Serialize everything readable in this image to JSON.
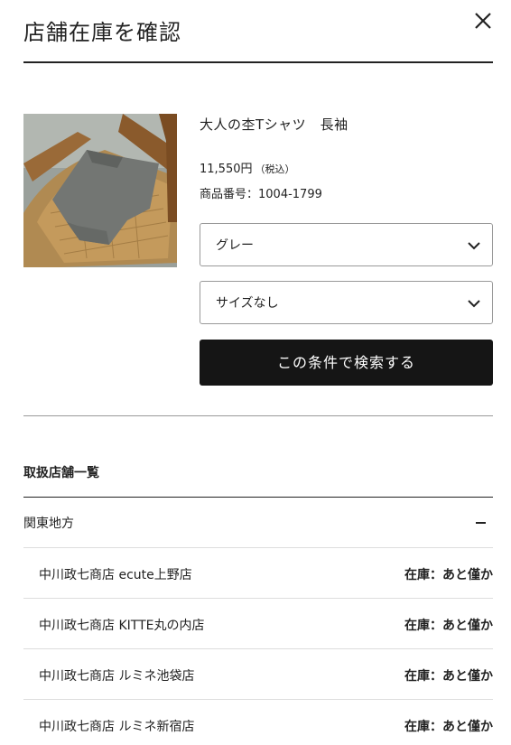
{
  "header": {
    "title": "店舗在庫を確認",
    "close_icon": "close-icon"
  },
  "product": {
    "name": "大人の杢Tシャツ　長袖",
    "price": "11,550円",
    "tax_note": "（税込）",
    "code_label": "商品番号：",
    "code": "1004-1799",
    "image_icon": "product-photo"
  },
  "filters": {
    "color": {
      "selected": "グレー",
      "icon": "chevron-down-icon"
    },
    "size": {
      "selected": "サイズなし",
      "icon": "chevron-down-icon"
    }
  },
  "search_button_label": "この条件で検索する",
  "store_list": {
    "title": "取扱店舗一覧",
    "region": {
      "label": "関東地方",
      "toggle_icon": "minus-icon",
      "expanded": true
    },
    "stores": [
      {
        "name": "中川政七商店 ecute上野店",
        "stock": "在庫：あと僅か"
      },
      {
        "name": "中川政七商店 KITTE丸の内店",
        "stock": "在庫：あと僅か"
      },
      {
        "name": "中川政七商店 ルミネ池袋店",
        "stock": "在庫：あと僅か"
      },
      {
        "name": "中川政七商店 ルミネ新宿店",
        "stock": "在庫：あと僅か"
      }
    ]
  },
  "colors": {
    "text": "#222222",
    "button_bg": "#151515",
    "button_text": "#ffffff",
    "border": "#999999",
    "row_divider": "#dddddd"
  }
}
